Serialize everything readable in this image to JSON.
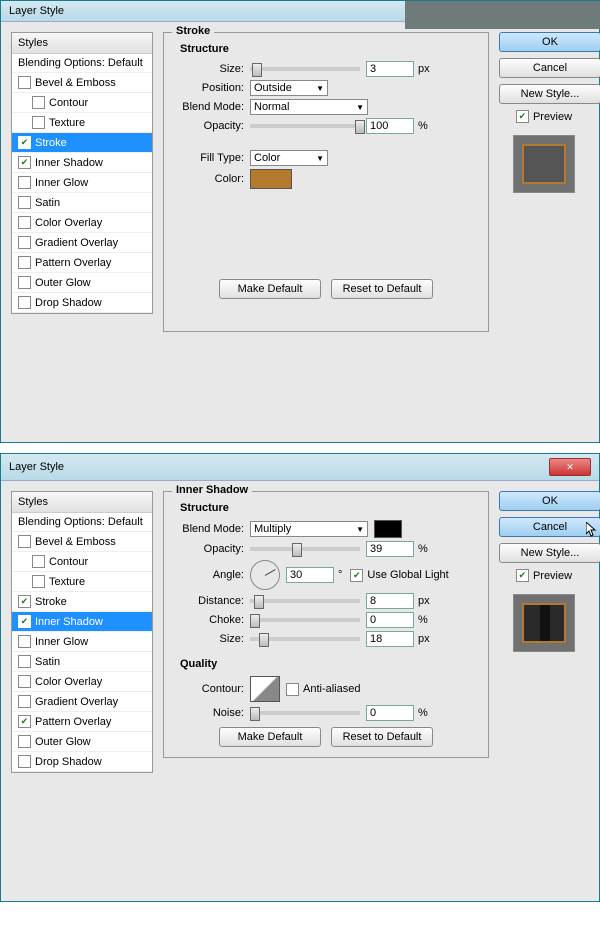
{
  "dialog1": {
    "title": "Layer Style",
    "stylesHeader": "Styles",
    "blendingOptions": "Blending Options: Default",
    "items": [
      {
        "label": "Bevel & Emboss",
        "checked": false,
        "indent": false,
        "selected": false
      },
      {
        "label": "Contour",
        "checked": false,
        "indent": true,
        "selected": false
      },
      {
        "label": "Texture",
        "checked": false,
        "indent": true,
        "selected": false
      },
      {
        "label": "Stroke",
        "checked": true,
        "indent": false,
        "selected": true
      },
      {
        "label": "Inner Shadow",
        "checked": true,
        "indent": false,
        "selected": false
      },
      {
        "label": "Inner Glow",
        "checked": false,
        "indent": false,
        "selected": false
      },
      {
        "label": "Satin",
        "checked": false,
        "indent": false,
        "selected": false
      },
      {
        "label": "Color Overlay",
        "checked": false,
        "indent": false,
        "selected": false
      },
      {
        "label": "Gradient Overlay",
        "checked": false,
        "indent": false,
        "selected": false
      },
      {
        "label": "Pattern Overlay",
        "checked": false,
        "indent": false,
        "selected": false
      },
      {
        "label": "Outer Glow",
        "checked": false,
        "indent": false,
        "selected": false
      },
      {
        "label": "Drop Shadow",
        "checked": false,
        "indent": false,
        "selected": false
      }
    ],
    "panelTitle": "Stroke",
    "structure": "Structure",
    "sizeLabel": "Size:",
    "sizeValue": "3",
    "px": "px",
    "positionLabel": "Position:",
    "positionValue": "Outside",
    "blendModeLabel": "Blend Mode:",
    "blendModeValue": "Normal",
    "opacityLabel": "Opacity:",
    "opacityValue": "100",
    "pct": "%",
    "fillTypeLabel": "Fill Type:",
    "fillTypeValue": "Color",
    "colorLabel": "Color:",
    "colorHex": "#b37a2e",
    "makeDefault": "Make Default",
    "resetDefault": "Reset to Default",
    "ok": "OK",
    "cancel": "Cancel",
    "newStyle": "New Style...",
    "preview": "Preview"
  },
  "dialog2": {
    "title": "Layer Style",
    "stylesHeader": "Styles",
    "blendingOptions": "Blending Options: Default",
    "items": [
      {
        "label": "Bevel & Emboss",
        "checked": false,
        "indent": false,
        "selected": false
      },
      {
        "label": "Contour",
        "checked": false,
        "indent": true,
        "selected": false
      },
      {
        "label": "Texture",
        "checked": false,
        "indent": true,
        "selected": false
      },
      {
        "label": "Stroke",
        "checked": true,
        "indent": false,
        "selected": false
      },
      {
        "label": "Inner Shadow",
        "checked": true,
        "indent": false,
        "selected": true
      },
      {
        "label": "Inner Glow",
        "checked": false,
        "indent": false,
        "selected": false
      },
      {
        "label": "Satin",
        "checked": false,
        "indent": false,
        "selected": false
      },
      {
        "label": "Color Overlay",
        "checked": false,
        "indent": false,
        "selected": false
      },
      {
        "label": "Gradient Overlay",
        "checked": false,
        "indent": false,
        "selected": false
      },
      {
        "label": "Pattern Overlay",
        "checked": true,
        "indent": false,
        "selected": false
      },
      {
        "label": "Outer Glow",
        "checked": false,
        "indent": false,
        "selected": false
      },
      {
        "label": "Drop Shadow",
        "checked": false,
        "indent": false,
        "selected": false
      }
    ],
    "panelTitle": "Inner Shadow",
    "structure": "Structure",
    "blendModeLabel": "Blend Mode:",
    "blendModeValue": "Multiply",
    "blendColor": "#000000",
    "opacityLabel": "Opacity:",
    "opacityValue": "39",
    "pct": "%",
    "angleLabel": "Angle:",
    "angleValue": "30",
    "deg": "°",
    "globalLight": "Use Global Light",
    "distanceLabel": "Distance:",
    "distanceValue": "8",
    "px": "px",
    "chokeLabel": "Choke:",
    "chokeValue": "0",
    "sizeLabel": "Size:",
    "sizeValue": "18",
    "quality": "Quality",
    "contourLabel": "Contour:",
    "antiAliased": "Anti-aliased",
    "noiseLabel": "Noise:",
    "noiseValue": "0",
    "makeDefault": "Make Default",
    "resetDefault": "Reset to Default",
    "ok": "OK",
    "cancel": "Cancel",
    "newStyle": "New Style...",
    "preview": "Preview"
  }
}
